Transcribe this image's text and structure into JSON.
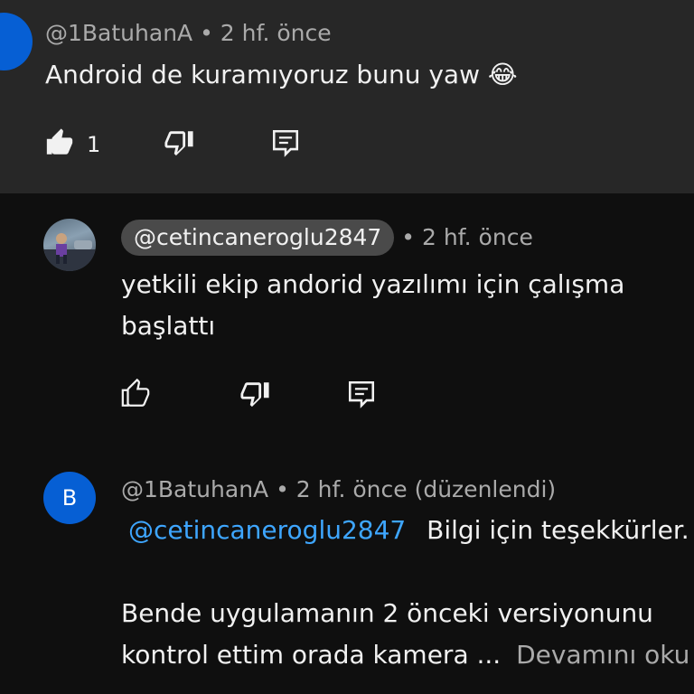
{
  "comment1": {
    "author": "@1BatuhanA",
    "time": "2 hf. önce",
    "text": "Android de kuramıyoruz bunu yaw 😂",
    "like_count": "1",
    "avatar_color": "#065fd4"
  },
  "reply1": {
    "author": "@cetincaneroglu2847",
    "time": "2 hf. önce",
    "text_line1": "yetkili ekip andorid yazılımı için çalışma",
    "text_line2": "başlattı"
  },
  "reply2": {
    "author": "@1BatuhanA",
    "time": "2 hf. önce",
    "edited": "(düzenlendi)",
    "avatar_letter": "B",
    "avatar_color": "#065fd4",
    "mention": "@cetincaneroglu2847",
    "text_line1": "Bilgi için teşekkürler.",
    "text_line2": "Bende uygulamanın 2 önceki versiyonunu",
    "text_line3": "kontrol ettim orada kamera ...",
    "read_more": "Devamını oku"
  },
  "icons": {
    "like": "thumbs-up-icon",
    "dislike": "thumbs-down-icon",
    "reply": "reply-icon"
  }
}
